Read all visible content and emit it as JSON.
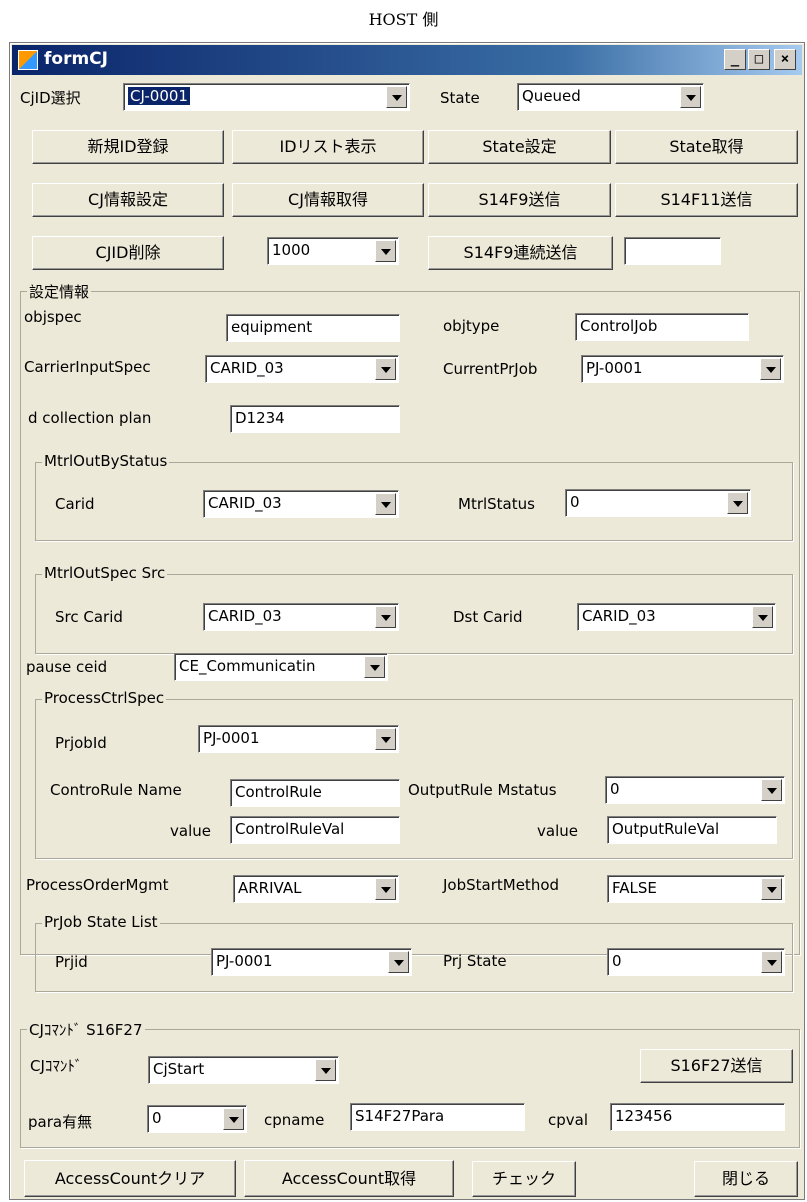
{
  "caption": "HOST 側",
  "window": {
    "title": "formCJ",
    "minimize": "_",
    "maximize": "□",
    "close": "×"
  },
  "top": {
    "cjid_label": "CjID選択",
    "cjid_value": "CJ-0001",
    "state_label": "State",
    "state_value": "Queued"
  },
  "buttons": {
    "new_id": "新規ID登録",
    "id_list": "IDリスト表示",
    "state_set": "State設定",
    "state_get": "State取得",
    "cj_info_set": "CJ情報設定",
    "cj_info_get": "CJ情報取得",
    "s14f9": "S14F9送信",
    "s14f11": "S14F11送信",
    "cjid_delete": "CJID削除",
    "s14f9_cont": "S14F9連続送信",
    "s16f27": "S16F27送信",
    "access_clear": "AccessCountクリア",
    "access_get": "AccessCount取得",
    "check": "チェック",
    "close": "閉じる"
  },
  "interval_value": "1000",
  "count_value": "",
  "settings": {
    "legend": "設定情報",
    "objspec_label": "objspec",
    "objspec_value": "equipment",
    "objtype_label": "objtype",
    "objtype_value": "ControlJob",
    "carrier_input_label": "CarrierInputSpec",
    "carrier_input_value": "CARID_03",
    "current_prjob_label": "CurrentPrJob",
    "current_prjob_value": "PJ-0001",
    "dcp_label": "d collection plan",
    "dcp_value": "D1234",
    "mtrl_out_by_status": {
      "legend": "MtrlOutByStatus",
      "carid_label": "Carid",
      "carid_value": "CARID_03",
      "mtrl_status_label": "MtrlStatus",
      "mtrl_status_value": "0"
    },
    "mtrl_out_spec": {
      "legend": "MtrlOutSpec Src",
      "src_label": "Src Carid",
      "src_value": "CARID_03",
      "dst_label": "Dst Carid",
      "dst_value": "CARID_03"
    },
    "pause_ceid_label": "pause ceid",
    "pause_ceid_value": "CE_Communicatin",
    "process_ctrl": {
      "legend": "ProcessCtrlSpec",
      "prjobid_label": "PrjobId",
      "prjobid_value": "PJ-0001",
      "ctrl_rule_label": "ControRule Name",
      "ctrl_rule_value": "ControlRule",
      "output_rule_label": "OutputRule Mstatus",
      "output_rule_value": "0",
      "value_label": "value",
      "ctrl_value": "ControlRuleVal",
      "output_value_label": "value",
      "output_value": "OutputRuleVal"
    },
    "order_mgmt_label": "ProcessOrderMgmt",
    "order_mgmt_value": "ARRIVAL",
    "job_start_label": "JobStartMethod",
    "job_start_value": "FALSE",
    "prjob_state": {
      "legend": "PrJob State List",
      "prjid_label": "Prjid",
      "prjid_value": "PJ-0001",
      "prj_state_label": "Prj State",
      "prj_state_value": "0"
    }
  },
  "cj_command": {
    "legend": "CJｺﾏﾝﾄﾞ S16F27",
    "cmd_label": "CJｺﾏﾝﾄﾞ",
    "cmd_value": "CjStart",
    "para_label": "para有無",
    "para_value": "0",
    "cpname_label": "cpname",
    "cpname_value": "S14F27Para",
    "cpval_label": "cpval",
    "cpval_value": "123456"
  }
}
